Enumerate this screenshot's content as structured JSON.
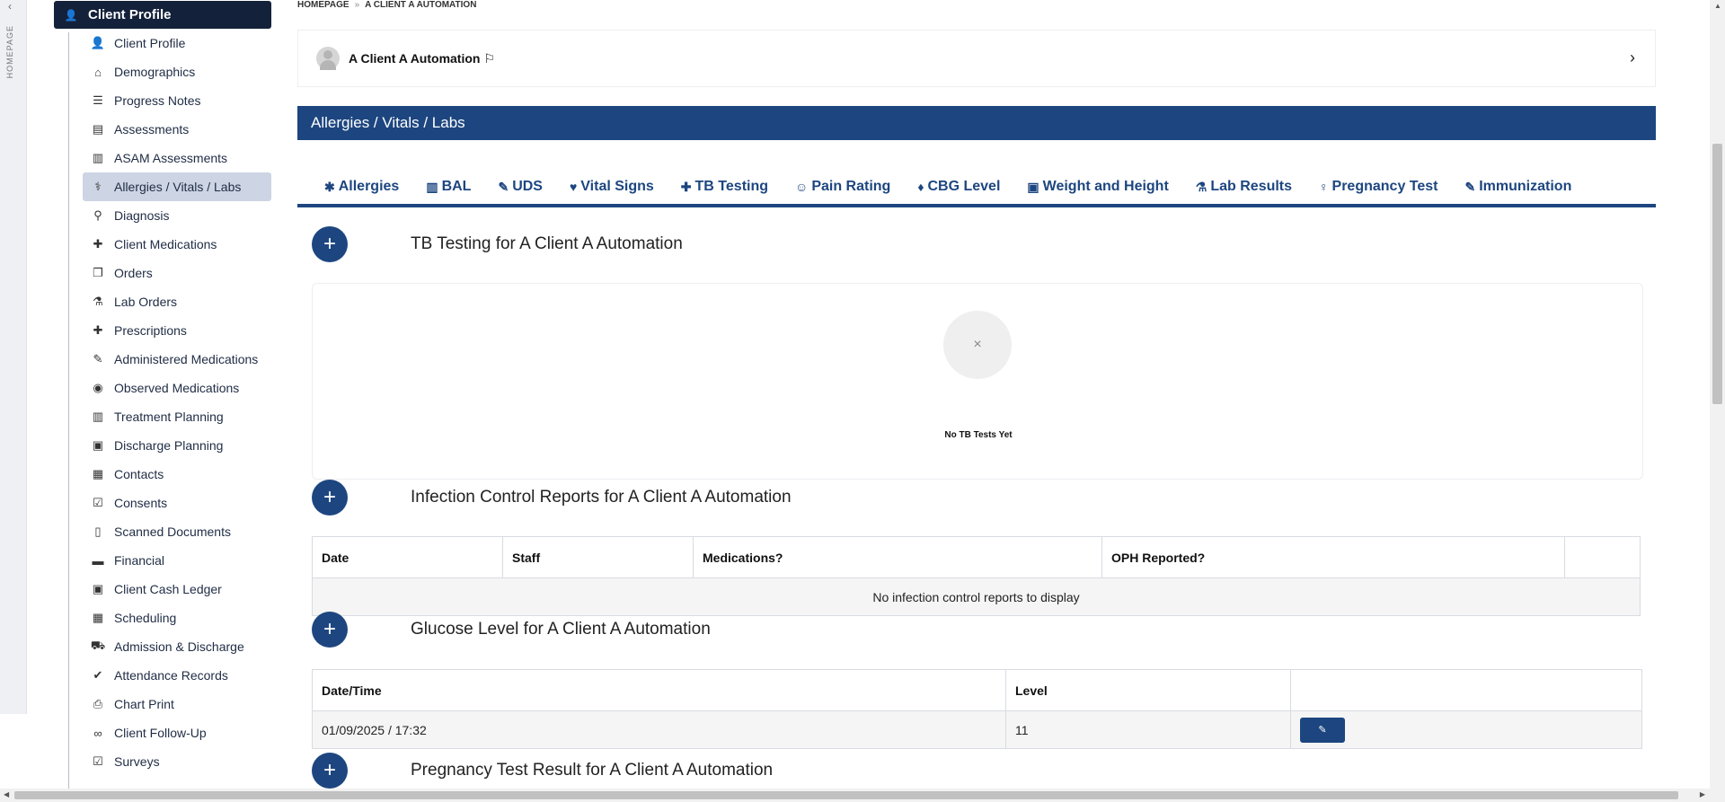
{
  "rail": {
    "label": "HOMEPAGE"
  },
  "sidebar": {
    "header": "Client Profile",
    "items": [
      {
        "label": "Client Profile",
        "icon": "user-icon",
        "glyph": "👤"
      },
      {
        "label": "Demographics",
        "icon": "home-icon",
        "glyph": "⌂"
      },
      {
        "label": "Progress Notes",
        "icon": "list-icon",
        "glyph": "☰"
      },
      {
        "label": "Assessments",
        "icon": "file-icon",
        "glyph": "▤"
      },
      {
        "label": "ASAM Assessments",
        "icon": "book-icon",
        "glyph": "▥"
      },
      {
        "label": "Allergies / Vitals / Labs",
        "icon": "stethoscope-icon",
        "glyph": "⚕"
      },
      {
        "label": "Diagnosis",
        "icon": "doctor-icon",
        "glyph": "⚲"
      },
      {
        "label": "Client Medications",
        "icon": "medkit-icon",
        "glyph": "✚"
      },
      {
        "label": "Orders",
        "icon": "copy-icon",
        "glyph": "❐"
      },
      {
        "label": "Lab Orders",
        "icon": "flask-icon",
        "glyph": "⚗"
      },
      {
        "label": "Prescriptions",
        "icon": "medkit-icon",
        "glyph": "✚"
      },
      {
        "label": "Administered Medications",
        "icon": "syringe-icon",
        "glyph": "✎"
      },
      {
        "label": "Observed Medications",
        "icon": "eye-icon",
        "glyph": "◉"
      },
      {
        "label": "Treatment Planning",
        "icon": "book-icon",
        "glyph": "▥"
      },
      {
        "label": "Discharge Planning",
        "icon": "suitcase-icon",
        "glyph": "▣"
      },
      {
        "label": "Contacts",
        "icon": "address-card-icon",
        "glyph": "▦"
      },
      {
        "label": "Consents",
        "icon": "check-square-icon",
        "glyph": "☑"
      },
      {
        "label": "Scanned Documents",
        "icon": "document-icon",
        "glyph": "▯"
      },
      {
        "label": "Financial",
        "icon": "credit-card-icon",
        "glyph": "▬"
      },
      {
        "label": "Client Cash Ledger",
        "icon": "money-icon",
        "glyph": "▣"
      },
      {
        "label": "Scheduling",
        "icon": "calendar-icon",
        "glyph": "▦"
      },
      {
        "label": "Admission & Discharge",
        "icon": "car-icon",
        "glyph": "⛟"
      },
      {
        "label": "Attendance Records",
        "icon": "check-icon",
        "glyph": "✔"
      },
      {
        "label": "Chart Print",
        "icon": "print-icon",
        "glyph": "⎙"
      },
      {
        "label": "Client Follow-Up",
        "icon": "binoculars-icon",
        "glyph": "∞"
      },
      {
        "label": "Surveys",
        "icon": "check-square-icon",
        "glyph": "☑"
      }
    ]
  },
  "breadcrumb": {
    "home": "HOMEPAGE",
    "sep": "»",
    "current": "A CLIENT A AUTOMATION"
  },
  "client": {
    "name": "A Client A Automation"
  },
  "panel": {
    "title": "Allergies / Vitals / Labs"
  },
  "tabs": [
    {
      "label": "Allergies",
      "icon": "bug-icon",
      "glyph": "✱"
    },
    {
      "label": "BAL",
      "icon": "bar-chart-icon",
      "glyph": "▥"
    },
    {
      "label": "UDS",
      "icon": "eyedropper-icon",
      "glyph": "✎"
    },
    {
      "label": "Vital Signs",
      "icon": "heartbeat-icon",
      "glyph": "♥"
    },
    {
      "label": "TB Testing",
      "icon": "medkit-icon",
      "glyph": "✚"
    },
    {
      "label": "Pain Rating",
      "icon": "smile-icon",
      "glyph": "☺"
    },
    {
      "label": "CBG Level",
      "icon": "droplet-icon",
      "glyph": "♦"
    },
    {
      "label": "Weight and Height",
      "icon": "weight-icon",
      "glyph": "▣"
    },
    {
      "label": "Lab Results",
      "icon": "flask-icon",
      "glyph": "⚗"
    },
    {
      "label": "Pregnancy Test",
      "icon": "female-icon",
      "glyph": "♀"
    },
    {
      "label": "Immunization",
      "icon": "syringe-icon",
      "glyph": "✎"
    }
  ],
  "sections": {
    "tb": {
      "title": "TB Testing for A Client A Automation",
      "empty": "No TB Tests Yet",
      "empty_glyph": "×"
    },
    "infection": {
      "title": "Infection Control Reports for A Client A Automation",
      "columns": [
        "Date",
        "Staff",
        "Medications?",
        "OPH Reported?",
        ""
      ],
      "empty": "No infection control reports to display"
    },
    "glucose": {
      "title": "Glucose Level for A Client A Automation",
      "columns": [
        "Date/Time",
        "Level",
        ""
      ],
      "rows": [
        {
          "datetime": "01/09/2025 / 17:32",
          "level": "11"
        }
      ]
    },
    "pregnancy": {
      "title": "Pregnancy Test Result for A Client A Automation"
    }
  },
  "colors": {
    "primary": "#1d4680",
    "sidebar_header": "#14213a",
    "active_item": "#cdd5e4"
  }
}
